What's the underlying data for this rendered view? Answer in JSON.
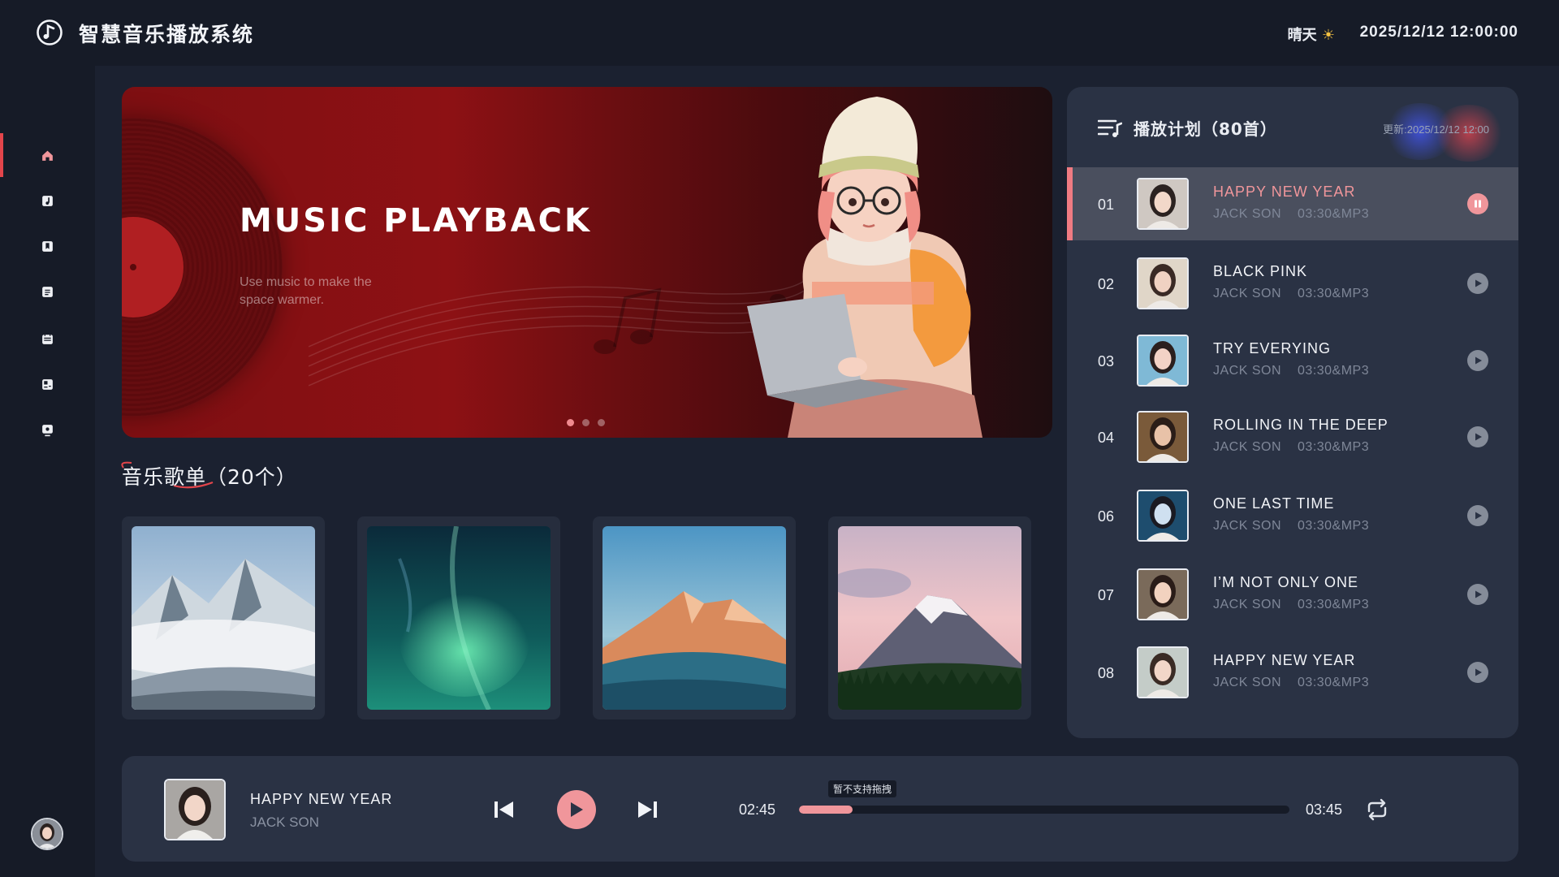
{
  "header": {
    "app_title": "智慧音乐播放系统",
    "weather": "晴天",
    "datetime": "2025/12/12 12:00:00"
  },
  "sidebar": {
    "items": [
      {
        "icon": "home-icon",
        "active": true
      },
      {
        "icon": "music-note-icon",
        "active": false
      },
      {
        "icon": "bookmark-icon",
        "active": false
      },
      {
        "icon": "document-icon",
        "active": false
      },
      {
        "icon": "calendar-icon",
        "active": false
      },
      {
        "icon": "tag-icon",
        "active": false
      },
      {
        "icon": "monitor-icon",
        "active": false
      }
    ]
  },
  "banner": {
    "title": "MUSIC PLAYBACK",
    "subtitle": "Use music to make the space warmer.",
    "slides": 3,
    "active_slide": 1
  },
  "playlists": {
    "title": "音乐歌单（20个）",
    "cards": [
      {
        "image": "snowy-mountains-clouds"
      },
      {
        "image": "aurora-night-sky"
      },
      {
        "image": "sunset-mountain-peak"
      },
      {
        "image": "volcano-pink-sky-forest"
      }
    ]
  },
  "plan": {
    "title": "播放计划（80首）",
    "updated": "更新:2025/12/12 12:00",
    "songs": [
      {
        "num": "01",
        "name": "HAPPY NEW YEAR",
        "artist": "JACK SON",
        "info": "03:30&MP3",
        "playing": true
      },
      {
        "num": "02",
        "name": "BLACK PINK",
        "artist": "JACK SON",
        "info": "03:30&MP3",
        "playing": false
      },
      {
        "num": "03",
        "name": "TRY EVERYING",
        "artist": "JACK SON",
        "info": "03:30&MP3",
        "playing": false
      },
      {
        "num": "04",
        "name": "ROLLING IN THE DEEP",
        "artist": "JACK SON",
        "info": "03:30&MP3",
        "playing": false
      },
      {
        "num": "06",
        "name": "ONE LAST TIME",
        "artist": "JACK SON",
        "info": "03:30&MP3",
        "playing": false
      },
      {
        "num": "07",
        "name": "I’M NOT ONLY ONE",
        "artist": "JACK SON",
        "info": "03:30&MP3",
        "playing": false
      },
      {
        "num": "08",
        "name": "HAPPY NEW YEAR",
        "artist": "JACK SON",
        "info": "03:30&MP3",
        "playing": false
      }
    ]
  },
  "player": {
    "title": "HAPPY NEW YEAR",
    "artist": "JACK SON",
    "current_time": "02:45",
    "total_time": "03:45",
    "progress": 0.11,
    "tooltip": "暂不支持拖拽"
  },
  "colors": {
    "accent": "#f0969b",
    "background": "#1b2130",
    "panel": "#2a3244",
    "banner_red": "#8d1114"
  }
}
